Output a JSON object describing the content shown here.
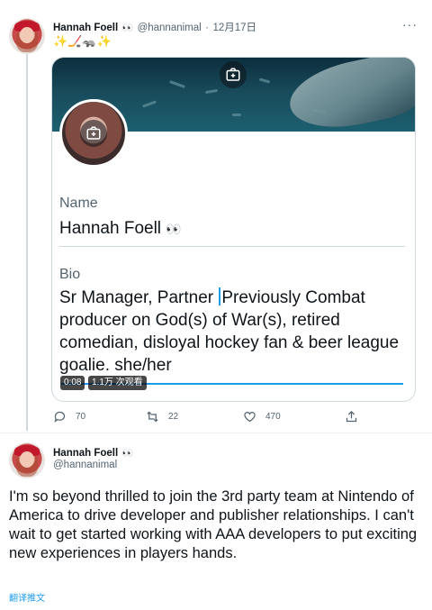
{
  "quoted_tweet": {
    "author_name": "Hannah Foell",
    "author_emoji": "👀",
    "handle": "@hannanimal",
    "separator": "·",
    "date": "12月17日",
    "line_emoji": "✨🏒🦡✨",
    "more_label": "···"
  },
  "card": {
    "name_label": "Name",
    "name_value": "Hannah Foell",
    "name_emoji": "👀",
    "bio_label": "Bio",
    "bio_before_caret": "Sr Manager, Partner ",
    "bio_after_caret": "Previously Combat producer on God(s) of War(s), retired comedian, disloyal hockey fan & beer league goalie. she/her",
    "video_time": "0:08",
    "video_views": "1.1万 次观看"
  },
  "actions": {
    "reply_count": "70",
    "retweet_count": "22",
    "like_count": "470"
  },
  "main_tweet": {
    "author_name": "Hannah Foell",
    "author_emoji": "👀",
    "handle": "@hannanimal",
    "text": "I'm so beyond thrilled to join the 3rd party team at Nintendo of America to drive developer and publisher relationships. I can't wait to get started working with AAA developers to put exciting new experiences in players hands.",
    "translate_label": "翻译推文"
  },
  "colors": {
    "accent": "#1d9bf0",
    "secondary_text": "#536471",
    "border": "#cfd9de"
  }
}
